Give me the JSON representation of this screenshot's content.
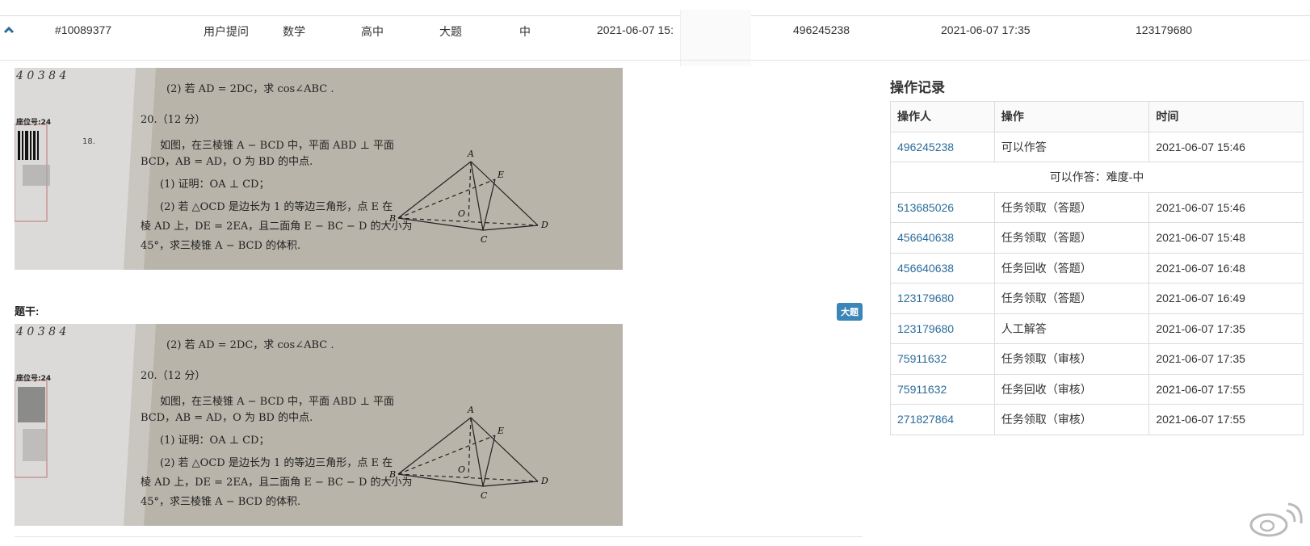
{
  "question_row": {
    "id": "#10089377",
    "source": "用户提问",
    "subject": "数学",
    "level": "高中",
    "type": "大题",
    "difficulty": "中",
    "created": "2021-06-07 15:",
    "creator": "496245238",
    "updated": "2021-06-07 17:35",
    "updater": "123179680"
  },
  "stem": {
    "label": "题干:",
    "badge": "大题"
  },
  "photo": {
    "numbers": "4 0 3 8 4",
    "seat": "座位号:24",
    "q18": "18.",
    "line_top": "(2) 若 AD = 2DC，求 cos∠ABC .",
    "q20": "20.（12 分）",
    "p1": "如图，在三棱锥 A − BCD 中，平面 ABD ⊥ 平面",
    "p2": "BCD，AB = AD，O 为 BD 的中点.",
    "p3": "(1) 证明：OA ⊥ CD；",
    "p4": "(2) 若 △OCD 是边长为 1 的等边三角形，点 E 在",
    "p5": "棱 AD 上，DE = 2EA，且二面角 E − BC − D 的大小为",
    "p6": "45°，求三棱锥 A − BCD 的体积.",
    "labels": {
      "A": "A",
      "B": "B",
      "C": "C",
      "D": "D",
      "E": "E",
      "O": "O"
    }
  },
  "log": {
    "title": "操作记录",
    "headers": [
      "操作人",
      "操作",
      "时间"
    ],
    "rows": [
      {
        "user": "496245238",
        "action": "可以作答",
        "time": "2021-06-07 15:46"
      },
      {
        "note": "可以作答：难度-中"
      },
      {
        "user": "513685026",
        "action": "任务领取（答题）",
        "time": "2021-06-07 15:46"
      },
      {
        "user": "456640638",
        "action": "任务领取（答题）",
        "time": "2021-06-07 15:48"
      },
      {
        "user": "456640638",
        "action": "任务回收（答题）",
        "time": "2021-06-07 16:48"
      },
      {
        "user": "123179680",
        "action": "任务领取（答题）",
        "time": "2021-06-07 16:49"
      },
      {
        "user": "123179680",
        "action": "人工解答",
        "time": "2021-06-07 17:35"
      },
      {
        "user": "75911632",
        "action": "任务领取（审核）",
        "time": "2021-06-07 17:35"
      },
      {
        "user": "75911632",
        "action": "任务回收（审核）",
        "time": "2021-06-07 17:55"
      },
      {
        "user": "271827864",
        "action": "任务领取（审核）",
        "time": "2021-06-07 17:55"
      }
    ]
  },
  "icons": {
    "expand": "chevron-up-icon",
    "watermark": "weibo-icon"
  },
  "colors": {
    "link": "#2b6c9a",
    "badge": "#3a86b8"
  }
}
